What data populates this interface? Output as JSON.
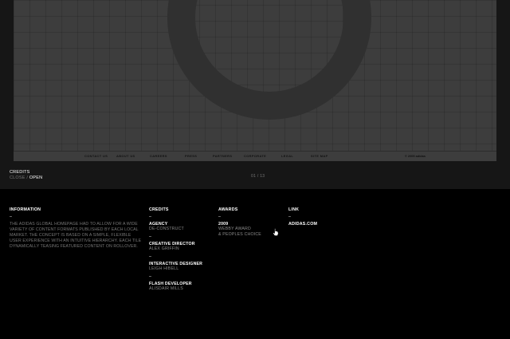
{
  "viewer": {
    "footer_links": [
      "CONTACT US",
      "ABOUT US",
      "CAREERS",
      "PRESS",
      "PARTNERS",
      "CORPORATE",
      "LEGAL",
      "SITE MAP"
    ],
    "copyright": "© 2009 adidas"
  },
  "toggle": {
    "title": "CREDITS",
    "close_label": "CLOSE",
    "separator": "/",
    "open_label": "OPEN"
  },
  "pager": "01 / 13",
  "info": {
    "heading": "INFORMATION",
    "dash": "–",
    "text": "THE ADIDAS GLOBAL HOMEPAGE HAD TO ALLOW FOR A WIDE VARIETY OF CONTENT FORMATS PUBLISHED BY EACH LOCAL MARKET. THE CONCEPT IS BASED ON A SIMPLE, FLEXIBLE USER EXPERIENCE WITH AN INTUITIVE HIERARCHY. EACH TILE DYNAMICALLY TEASING FEATURED CONTENT ON ROLLOVER."
  },
  "credits": {
    "heading": "CREDITS",
    "dash": "–",
    "entries": [
      {
        "role": "AGENCY",
        "name": "DE-CONSTRUCT",
        "dash": "–"
      },
      {
        "role": "CREATIVE DIRECTOR",
        "name": "ALEX GRIFFIN",
        "dash": "–"
      },
      {
        "role": "INTERACTIVE DESIGNER",
        "name": "LEIGH HIBELL",
        "dash": "–"
      },
      {
        "role": "FLASH DEVELOPER",
        "name": "ALISDAIR MILLS",
        "dash": ""
      }
    ]
  },
  "awards": {
    "heading": "AWARDS",
    "dash": "–",
    "year": "2009",
    "lines": [
      "WEBBY AWARD",
      "& PEOPLES CHOICE"
    ]
  },
  "link": {
    "heading": "LINK",
    "dash": "–",
    "label": "ADIDAS.COM"
  },
  "colors": {
    "background": "#000000",
    "panel": "#161616",
    "viewer": "#3d3d3d",
    "muted_text": "#777777"
  }
}
